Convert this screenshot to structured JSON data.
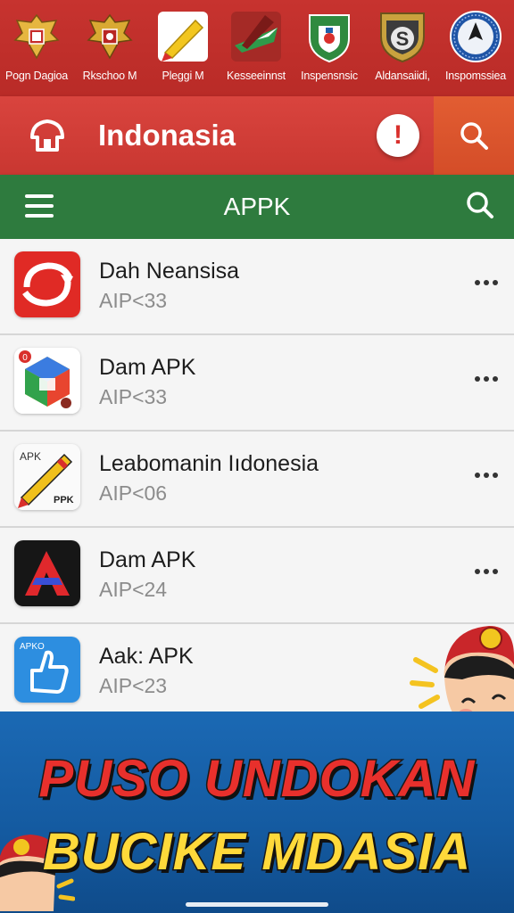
{
  "top_strip": {
    "items": [
      {
        "label": "Pogn Dagioa",
        "icon": "garuda-emblem-icon"
      },
      {
        "label": "Rkschoo M",
        "icon": "garuda-emblem-icon"
      },
      {
        "label": "Pleggi M",
        "icon": "pencil-app-icon"
      },
      {
        "label": "Kesseeinnst",
        "icon": "ribbon-app-icon"
      },
      {
        "label": "Inspensnsic",
        "icon": "green-shield-icon"
      },
      {
        "label": "Aldansaiidi,",
        "icon": "s-shield-icon"
      },
      {
        "label": "Inspomssiea",
        "icon": "round-seal-icon"
      }
    ]
  },
  "header": {
    "title": "Indonasia",
    "home_icon": "home-icon",
    "alert_icon": "alert-icon",
    "alert_glyph": "!",
    "search_icon": "search-icon"
  },
  "toolbar": {
    "title": "APPK",
    "menu_icon": "menu-icon",
    "search_icon": "search-icon"
  },
  "apps": [
    {
      "name": "Dah Neansisa",
      "sub": "AIP<33",
      "icon": "red-sync-icon"
    },
    {
      "name": "Dam APK",
      "sub": "AIP<33",
      "icon": "colorful-cube-icon"
    },
    {
      "name": "Leabomanin Iıdonesia",
      "sub": "AIP<06",
      "icon": "pencil-apk-icon"
    },
    {
      "name": "Dam APK",
      "sub": "AIP<24",
      "icon": "black-a-icon"
    },
    {
      "name": "Aak: APK",
      "sub": "AIP<23",
      "icon": "blue-thumb-icon"
    }
  ],
  "banner": {
    "line1": "PUSO UNDOKAN",
    "line2": "BUCIKE MDASIA"
  },
  "icon_text": {
    "cube_badge": "0",
    "pencil_top": "APK",
    "pencil_bottom": "PPK",
    "thumb_label": "APKO",
    "seal_letter": "S"
  },
  "colors": {
    "red": "#c7332f",
    "green": "#2e7b3e",
    "orange": "#d9512b",
    "banner_blue": "#1b69b4"
  }
}
